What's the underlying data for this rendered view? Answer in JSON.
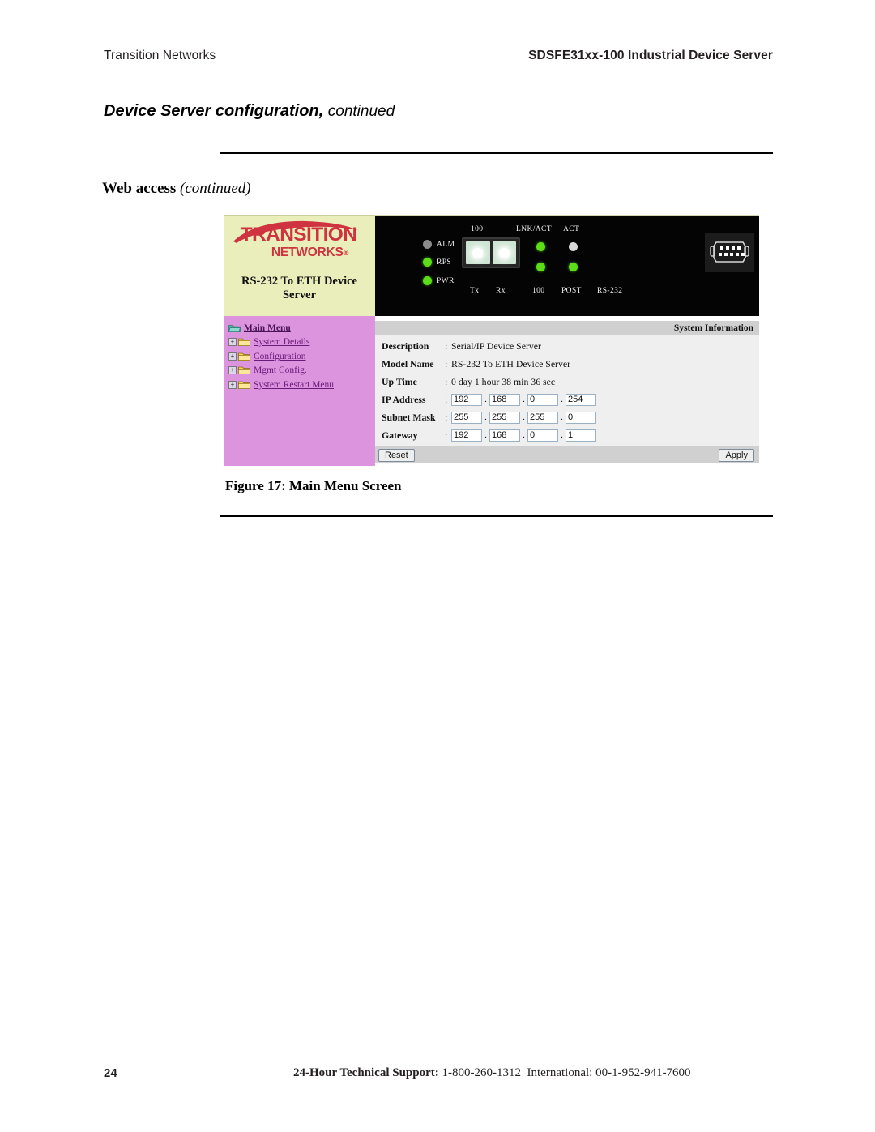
{
  "header": {
    "left": "Transition Networks",
    "right": "SDSFE31xx-100 Industrial Device Server"
  },
  "chapter": {
    "title": "Device Server configuration,",
    "continued": "continued"
  },
  "section": {
    "title": "Web access",
    "continued": "(continued)"
  },
  "device_ui": {
    "brand": {
      "logo_line1": "TRANSITION",
      "logo_line2": "NETWORKS",
      "registered_mark": "®",
      "subtitle_line1": "RS-232 To ETH Device",
      "subtitle_line2": "Server"
    },
    "led_panel": {
      "top_labels": [
        {
          "text": "100"
        },
        {
          "text": "LNK/ACT"
        },
        {
          "text": "ACT"
        }
      ],
      "status_leds": [
        {
          "label": "ALM",
          "color": "#8b8b8b",
          "state": "off"
        },
        {
          "label": "RPS",
          "color": "#5ddc18",
          "state": "on"
        },
        {
          "label": "PWR",
          "color": "#5ddc18",
          "state": "on"
        }
      ],
      "bottom_labels": [
        {
          "text": "Tx"
        },
        {
          "text": "Rx"
        },
        {
          "text": "100"
        },
        {
          "text": "POST"
        },
        {
          "text": "RS-232"
        }
      ],
      "link_leds": [
        {
          "name": "lnk-act-upper",
          "color": "#5ddc18"
        },
        {
          "name": "lnk-act-lower",
          "color": "#5ddc18"
        },
        {
          "name": "act-upper",
          "color": "#d9d9d9"
        },
        {
          "name": "act-lower",
          "color": "#5ddc18"
        }
      ]
    },
    "nav_tree": {
      "root": {
        "label": "Main Menu",
        "icon": "open-folder-icon"
      },
      "items": [
        {
          "label": "System Details",
          "icon": "folder-icon",
          "expander": "+"
        },
        {
          "label": "Configuration",
          "icon": "folder-icon",
          "expander": "+"
        },
        {
          "label": "Mgmt Config.",
          "icon": "folder-icon",
          "expander": "+"
        },
        {
          "label": "System Restart Menu",
          "icon": "folder-icon",
          "expander": "+"
        }
      ]
    },
    "panel": {
      "title": "System Information",
      "rows": [
        {
          "key": "Description",
          "colon": ":",
          "value": "Serial/IP Device Server"
        },
        {
          "key": "Model Name",
          "colon": ":",
          "value": "RS-232 To ETH Device Server"
        },
        {
          "key": "Up Time",
          "colon": ":",
          "value": "0 day 1 hour 38 min 36 sec"
        }
      ],
      "ip_fields": [
        {
          "key": "IP Address",
          "colon": ":",
          "octets": [
            "192",
            "168",
            "0",
            "254"
          ]
        },
        {
          "key": "Subnet Mask",
          "colon": ":",
          "octets": [
            "255",
            "255",
            "255",
            "0"
          ]
        },
        {
          "key": "Gateway",
          "colon": ":",
          "octets": [
            "192",
            "168",
            "0",
            "1"
          ]
        }
      ],
      "buttons": {
        "reset": "Reset",
        "apply": "Apply"
      }
    },
    "colors": {
      "brand_red": "#cf3340",
      "brand_bg": "#eaeeba",
      "nav_bg": "#dd94de",
      "panel_bg": "#efefef",
      "bar_bg": "#d0d0d0",
      "led_green": "#5ddc18",
      "led_off": "#8b8b8b"
    }
  },
  "figure": {
    "caption": "Figure 17:  Main Menu Screen"
  },
  "footer": {
    "page_number": "24",
    "support_label": "24-Hour Technical Support:",
    "support_phone": "1-800-260-1312",
    "international_label": "International:",
    "international_phone": "00-1-952-941-7600"
  }
}
